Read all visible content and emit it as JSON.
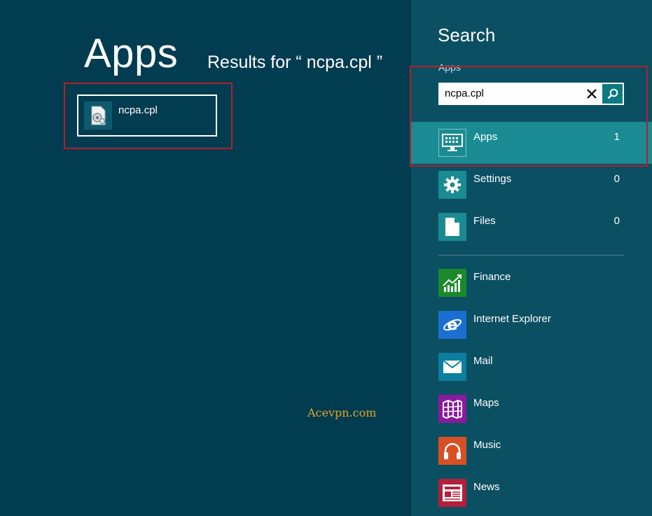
{
  "main": {
    "heading": "Apps",
    "results_text": "Results for “ ncpa.cpl ”",
    "result_item": {
      "label": "ncpa.cpl",
      "icon": "control-panel-file-icon"
    },
    "watermark": "Acevpn.com"
  },
  "search_pane": {
    "title": "Search",
    "scope_label": "Apps",
    "query": "ncpa.cpl",
    "clear_icon": "close-icon",
    "go_icon": "search-icon",
    "categories": [
      {
        "label": "Apps",
        "count": "1",
        "icon": "monitor-keyboard-icon",
        "color": "#1a8b93",
        "selected": true
      },
      {
        "label": "Settings",
        "count": "0",
        "icon": "gear-icon",
        "color": "#1a8b93"
      },
      {
        "label": "Files",
        "count": "0",
        "icon": "document-icon",
        "color": "#1a8b93"
      }
    ],
    "apps": [
      {
        "label": "Finance",
        "icon": "finance-chart-icon",
        "color": "#1a8a2a"
      },
      {
        "label": "Internet Explorer",
        "icon": "internet-explorer-icon",
        "color": "#1a6fd0"
      },
      {
        "label": "Mail",
        "icon": "mail-envelope-icon",
        "color": "#0a7fa0"
      },
      {
        "label": "Maps",
        "icon": "map-icon",
        "color": "#8b1aa0"
      },
      {
        "label": "Music",
        "icon": "headphones-icon",
        "color": "#d84f23"
      },
      {
        "label": "News",
        "icon": "newspaper-icon",
        "color": "#b31f3a"
      }
    ]
  },
  "colors": {
    "background": "#023c50",
    "pane": "#0b4f62",
    "highlight": "#1a8b93",
    "annotation": "#b3202a",
    "watermark": "#e0a526"
  }
}
